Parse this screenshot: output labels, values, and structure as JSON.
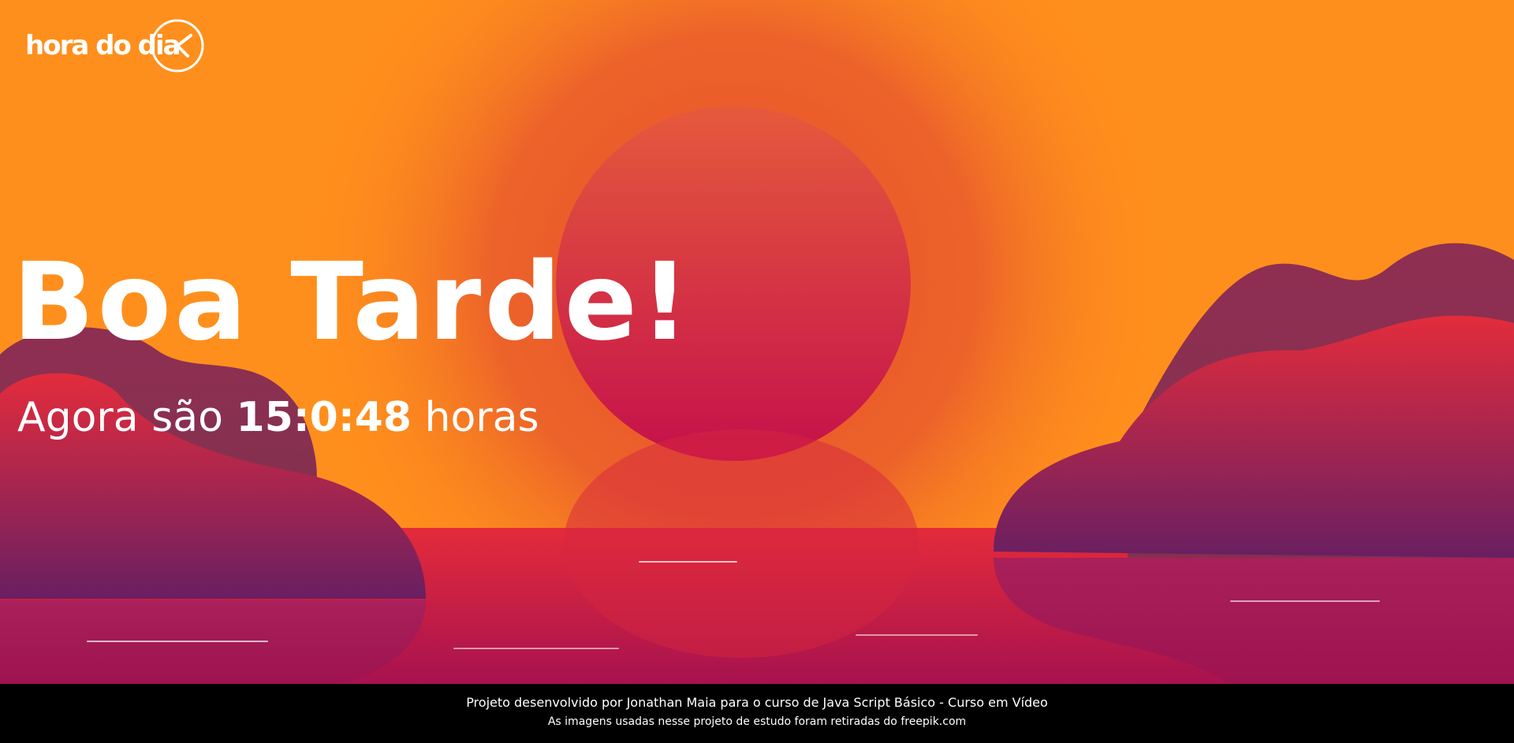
{
  "header": {
    "logo_text": "hora do dia",
    "logo_icon": "clock-icon"
  },
  "main": {
    "greeting": "Boa Tarde!",
    "time_prefix": "Agora são",
    "time_value": "15:0:48",
    "time_suffix": "horas"
  },
  "scene": {
    "image": "sunset-illustration",
    "colors": {
      "sky": "#ff8f1c",
      "sun_top": "#e15b3e",
      "sun_bottom": "#c8124a",
      "sea_top": "#e42b3a",
      "sea_bottom": "#a2124f",
      "hills": "#7a2560"
    }
  },
  "footer": {
    "line1": "Projeto desenvolvido por Jonathan Maia para o curso de Java Script Básico - Curso em Vídeo",
    "line2": "As imagens usadas nesse projeto de estudo foram retiradas do freepik.com"
  }
}
